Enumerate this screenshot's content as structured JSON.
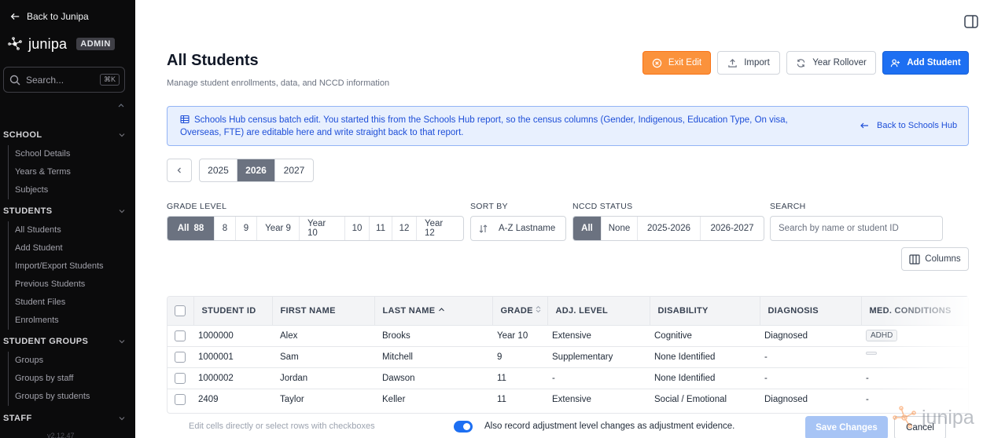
{
  "sidebar": {
    "back_label": "Back to Junipa",
    "brand": "junipa",
    "admin_badge": "ADMIN",
    "search_placeholder": "Search...",
    "search_shortcut": "⌘K",
    "sections": [
      {
        "title": "SCHOOL",
        "items": [
          "School Details",
          "Years & Terms",
          "Subjects"
        ]
      },
      {
        "title": "STUDENTS",
        "items": [
          "All Students",
          "Add Student",
          "Import/Export Students",
          "Previous Students",
          "Student Files",
          "Enrolments"
        ]
      },
      {
        "title": "STUDENT GROUPS",
        "items": [
          "Groups",
          "Groups by staff",
          "Groups by students"
        ]
      },
      {
        "title": "STAFF",
        "items": []
      }
    ],
    "version": "v2.12.47"
  },
  "header": {
    "title": "All Students",
    "subtitle": "Manage student enrollments, data, and NCCD information",
    "exit_edit": "Exit Edit",
    "import": "Import",
    "year_rollover": "Year Rollover",
    "add_student": "Add Student"
  },
  "banner": {
    "text": "Schools Hub census batch edit. You started this from the Schools Hub report, so the census columns (Gender, Indigenous, Education Type, On visa, Overseas, FTE) are editable here and write straight back to that report.",
    "back_link": "Back to Schools Hub"
  },
  "years": {
    "options": [
      "2025",
      "2026",
      "2027"
    ],
    "selected": "2026"
  },
  "filters": {
    "grade_label": "GRADE LEVEL",
    "grade_all": "All",
    "grade_count": "88",
    "grade_options": [
      "8",
      "9",
      "Year 9",
      "Year 10",
      "10",
      "11",
      "12",
      "Year 12"
    ],
    "sort_label": "SORT BY",
    "sort_value": "A-Z Lastname",
    "nccd_label": "NCCD STATUS",
    "nccd_options": [
      "All",
      "None",
      "2025-2026",
      "2026-2027"
    ],
    "nccd_selected": "All",
    "search_label": "SEARCH",
    "search_placeholder": "Search by name or student ID",
    "columns_button": "Columns"
  },
  "table": {
    "columns": [
      "STUDENT ID",
      "FIRST NAME",
      "LAST NAME",
      "GRADE",
      "ADJ. LEVEL",
      "DISABILITY",
      "DIAGNOSIS",
      "MED. CONDITIONS"
    ],
    "rows": [
      {
        "id": "1000000",
        "first": "Alex",
        "last": "Brooks",
        "grade": "Year 10",
        "adj": "Extensive",
        "disability": "Cognitive",
        "diagnosis": "Diagnosed",
        "med": "ADHD"
      },
      {
        "id": "1000001",
        "first": "Sam",
        "last": "Mitchell",
        "grade": "9",
        "adj": "Supplementary",
        "disability": "None Identified",
        "diagnosis": "-",
        "med": ""
      },
      {
        "id": "1000002",
        "first": "Jordan",
        "last": "Dawson",
        "grade": "11",
        "adj": "-",
        "disability": "None Identified",
        "diagnosis": "-",
        "med": "-"
      },
      {
        "id": "2409",
        "first": "Taylor",
        "last": "Keller",
        "grade": "11",
        "adj": "Extensive",
        "disability": "Social / Emotional",
        "diagnosis": "Diagnosed",
        "med": "-"
      }
    ]
  },
  "footer": {
    "hint": "Edit cells directly or select rows with checkboxes",
    "toggle_label": "Also record adjustment level changes as adjustment evidence.",
    "toggle_on": true,
    "save": "Save Changes",
    "cancel": "Cancel",
    "watermark": "junipa"
  },
  "colors": {
    "accent": "#1d6ff2",
    "exit_edit": "#fb923c",
    "banner_bg": "#e8f0fe",
    "sidebar_bg": "#0b0b0c"
  }
}
